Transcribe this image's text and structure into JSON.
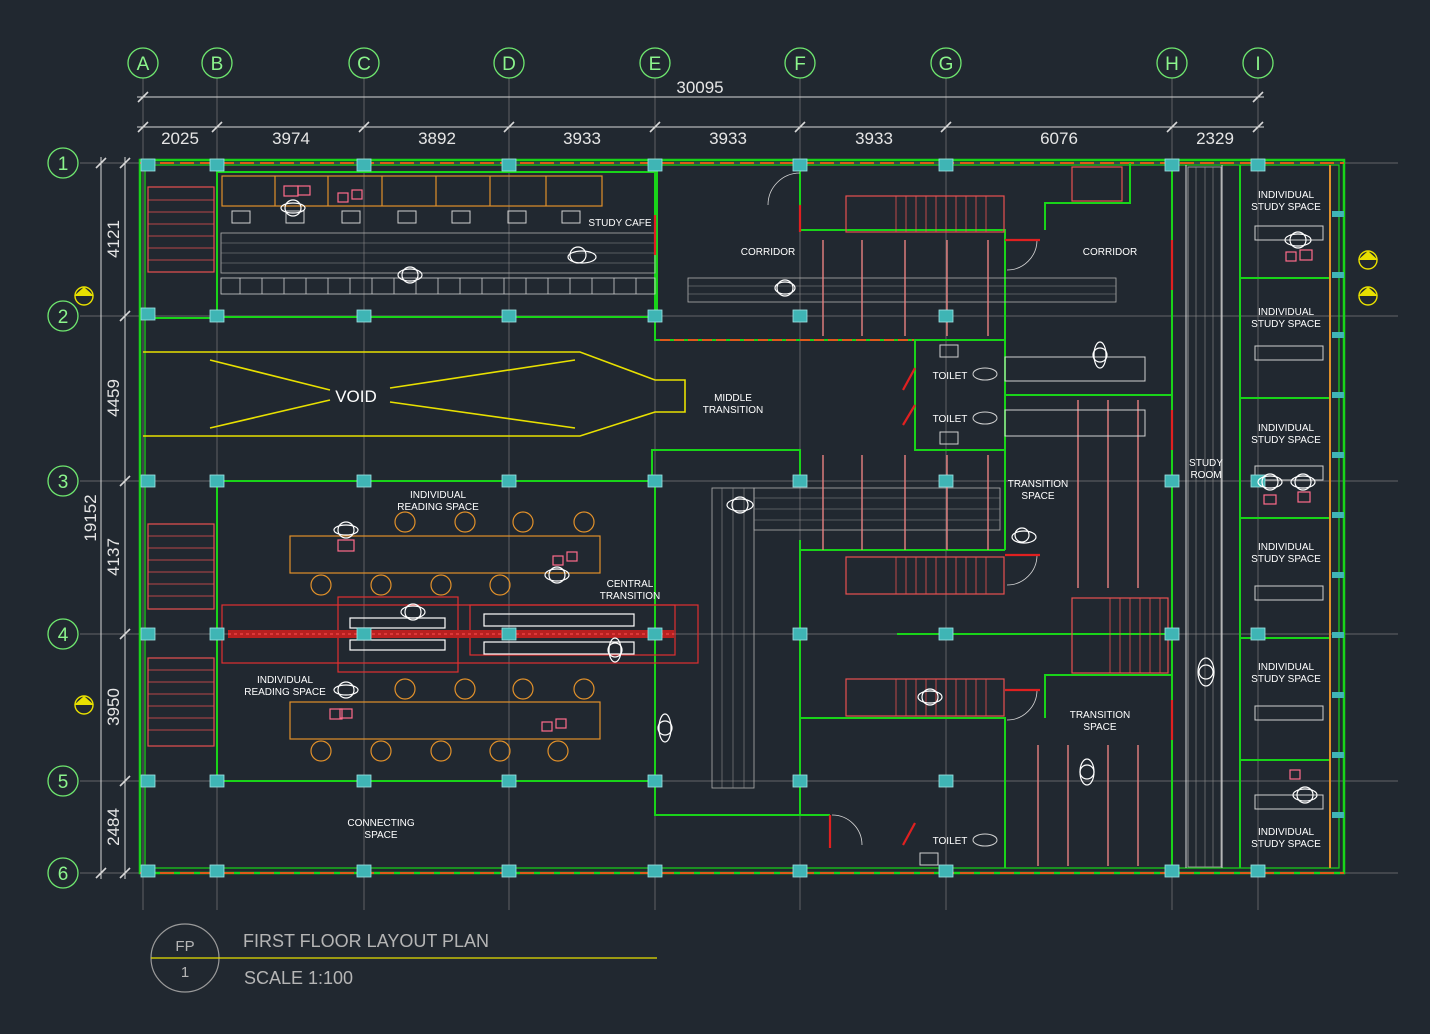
{
  "drawing": {
    "title": "FIRST FLOOR LAYOUT PLAN",
    "scale": "SCALE 1:100",
    "sheet_code": "FP",
    "sheet_number": "1"
  },
  "grid": {
    "columns": [
      "A",
      "B",
      "C",
      "D",
      "E",
      "F",
      "G",
      "H",
      "I"
    ],
    "rows": [
      "1",
      "2",
      "3",
      "4",
      "5",
      "6"
    ]
  },
  "dimensions": {
    "overall_width": "30095",
    "column_spacings": [
      "2025",
      "3974",
      "3892",
      "3933",
      "3933",
      "3933",
      "6076",
      "2329"
    ],
    "overall_height": "19152",
    "row_spacings": [
      "4121",
      "4459",
      "4137",
      "3950",
      "2484"
    ]
  },
  "rooms": {
    "study_cafe": "STUDY CAFE",
    "corridor_left": "CORRIDOR",
    "corridor_right": "CORRIDOR",
    "void": "VOID",
    "middle_transition_1": "MIDDLE",
    "middle_transition_2": "TRANSITION",
    "toilet_1": "TOILET",
    "toilet_2": "TOILET",
    "toilet_3": "TOILET",
    "transition_space_1a": "TRANSITION",
    "transition_space_1b": "SPACE",
    "transition_space_2a": "TRANSITION",
    "transition_space_2b": "SPACE",
    "individual_reading_1a": "INDIVIDUAL",
    "individual_reading_1b": "READING  SPACE",
    "individual_reading_2a": "INDIVIDUAL",
    "individual_reading_2b": "READING  SPACE",
    "central_transition_a": "CENTRAL",
    "central_transition_b": "TRANSITION",
    "connecting_space_a": "CONNECTING",
    "connecting_space_b": "SPACE",
    "study_room_a": "STUDY",
    "study_room_b": "ROOM",
    "individual_study_a": "INDIVIDUAL",
    "individual_study_b": "STUDY  SPACE"
  },
  "colors": {
    "background": "#212830",
    "wall": "#19d419",
    "wall_inner": "#e8e000",
    "column": "#3fb5b5",
    "stair": "#e85050",
    "furniture": "#e0902a",
    "paving": "#b0b0b0",
    "grid_bubble": "#6fe86f",
    "dimension": "#e6e6e6"
  }
}
